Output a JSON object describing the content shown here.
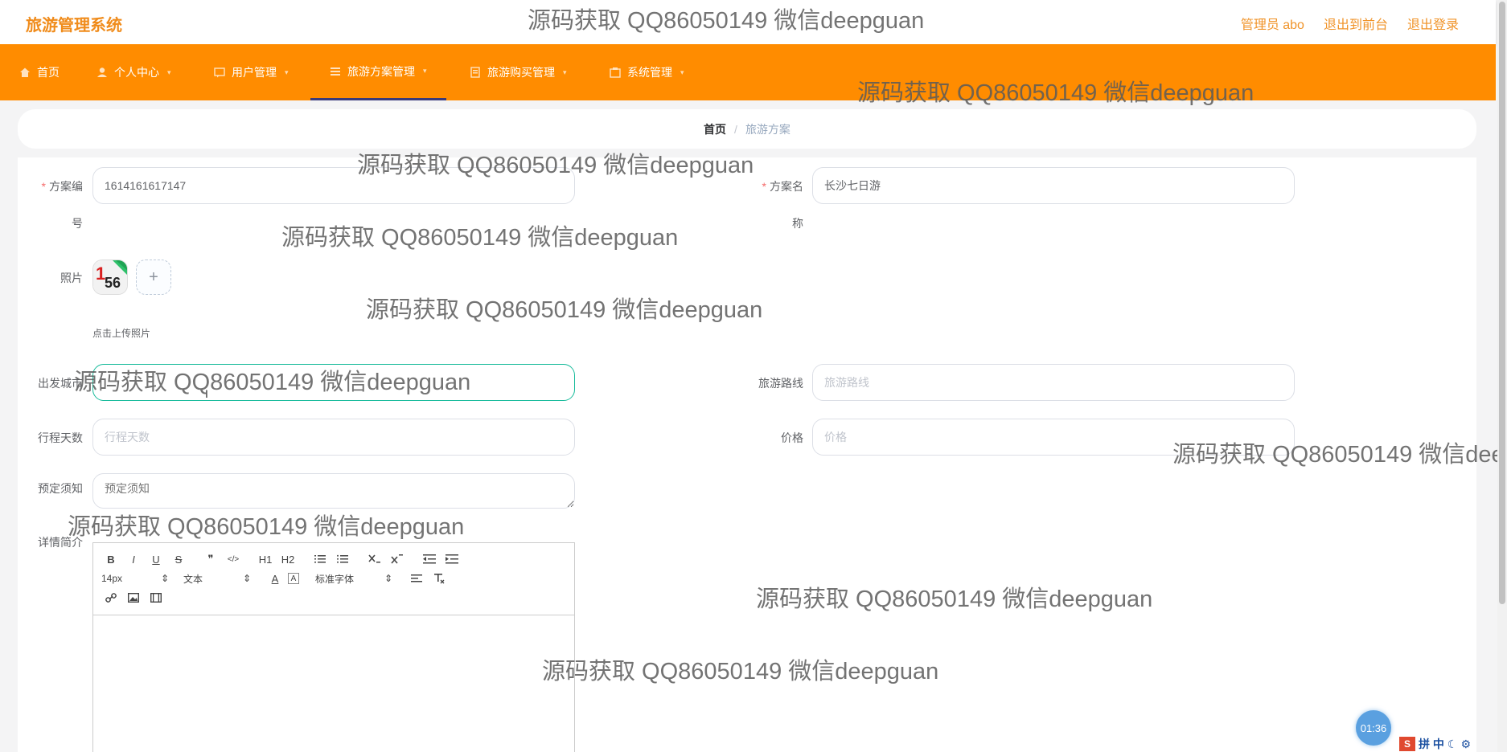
{
  "header": {
    "brand": "旅游管理系统",
    "user": "管理员 abo",
    "back_front": "退出到前台",
    "logout": "退出登录"
  },
  "nav": [
    {
      "label": "首页",
      "icon": "home-icon"
    },
    {
      "label": "个人中心",
      "icon": "user-icon"
    },
    {
      "label": "用户管理",
      "icon": "users-icon"
    },
    {
      "label": "旅游方案管理",
      "icon": "list-icon"
    },
    {
      "label": "旅游购买管理",
      "icon": "cart-icon"
    },
    {
      "label": "系统管理",
      "icon": "settings-icon"
    }
  ],
  "breadcrumb": {
    "home": "首页",
    "separator": "/",
    "current": "旅游方案"
  },
  "form": {
    "plan_no_label_1": "方案编",
    "plan_no_label_2": "号",
    "plan_no_value": "1614161617147",
    "plan_name_label_1": "方案名",
    "plan_name_label_2": "称",
    "plan_name_value": "长沙七日游",
    "photo_label": "照片",
    "upload_plus": "+",
    "upload_tip": "点击上传照片",
    "city_label": "出发城市",
    "route_label": "旅游路线",
    "route_placeholder": "旅游路线",
    "days_label": "行程天数",
    "days_placeholder": "行程天数",
    "price_label": "价格",
    "price_placeholder": "价格",
    "notice_label": "预定须知",
    "notice_placeholder": "预定须知",
    "detail_label": "详情简介",
    "required_mark": "*"
  },
  "editor": {
    "font_size": "14px",
    "block_type": "文本",
    "font_family": "标准字体",
    "buttons": [
      "B",
      "I",
      "U",
      "S",
      "❞",
      "</>",
      "H1",
      "H2"
    ]
  },
  "watermark": "源码获取 QQ86050149 微信deepguan",
  "timer": "01:36",
  "ime": {
    "s": "S",
    "text": "拼 中"
  }
}
